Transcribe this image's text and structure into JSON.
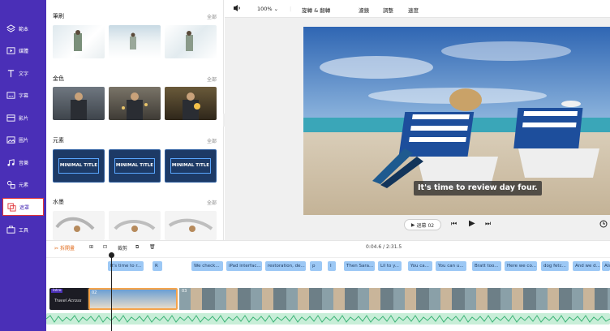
{
  "sidebar": {
    "items": [
      {
        "label": "範本",
        "icon": "layers-icon"
      },
      {
        "label": "媒體",
        "icon": "media-icon"
      },
      {
        "label": "文字",
        "icon": "text-icon"
      },
      {
        "label": "字幕",
        "icon": "subtitle-icon"
      },
      {
        "label": "影片",
        "icon": "video-icon"
      },
      {
        "label": "圖片",
        "icon": "image-icon"
      },
      {
        "label": "音樂",
        "icon": "music-icon"
      },
      {
        "label": "元素",
        "icon": "elements-icon"
      },
      {
        "label": "遮罩",
        "icon": "overlay-icon",
        "active": true
      },
      {
        "label": "工具",
        "icon": "tools-icon"
      }
    ]
  },
  "panel": {
    "sections": [
      {
        "title": "筆刷",
        "all": "全部"
      },
      {
        "title": "金色",
        "all": "全部"
      },
      {
        "title": "元素",
        "all": "全部"
      },
      {
        "title": "水墨",
        "all": "全部"
      }
    ],
    "minimal_title": "MINIMAL TITLE"
  },
  "toolbar": {
    "zoom": "100%",
    "items": [
      "旋轉 & 翻轉",
      "濾鏡",
      "調整",
      "速度"
    ]
  },
  "preview": {
    "subtitle": "It's time to review day four."
  },
  "controls": {
    "back_label": "退幕 02"
  },
  "timeline": {
    "split_label": "拆開畫",
    "cut_label": "裁剪",
    "time": "0:04.6 / 2:31.5",
    "captions": [
      "It's time to r...",
      "R",
      "We check...",
      "iPad interfac...",
      "restoration, de...",
      "p",
      "I",
      "Then Sara...",
      "Lil to y...",
      "You ca...",
      "You can u...",
      "Bratt too...",
      "Here we co...",
      "dog fetc...",
      "And we d...",
      "Also..."
    ],
    "clip_labels": [
      "01",
      "02",
      "03"
    ],
    "first_clip_text": "Travel Across",
    "first_clip_badge": "Intro"
  },
  "colors": {
    "sidebar": "#4a2fb7",
    "active_border": "#e0353a",
    "caption_chip": "#9cc8f5",
    "audio": "#c8eed8",
    "selected_clip": "#f5a34a"
  }
}
